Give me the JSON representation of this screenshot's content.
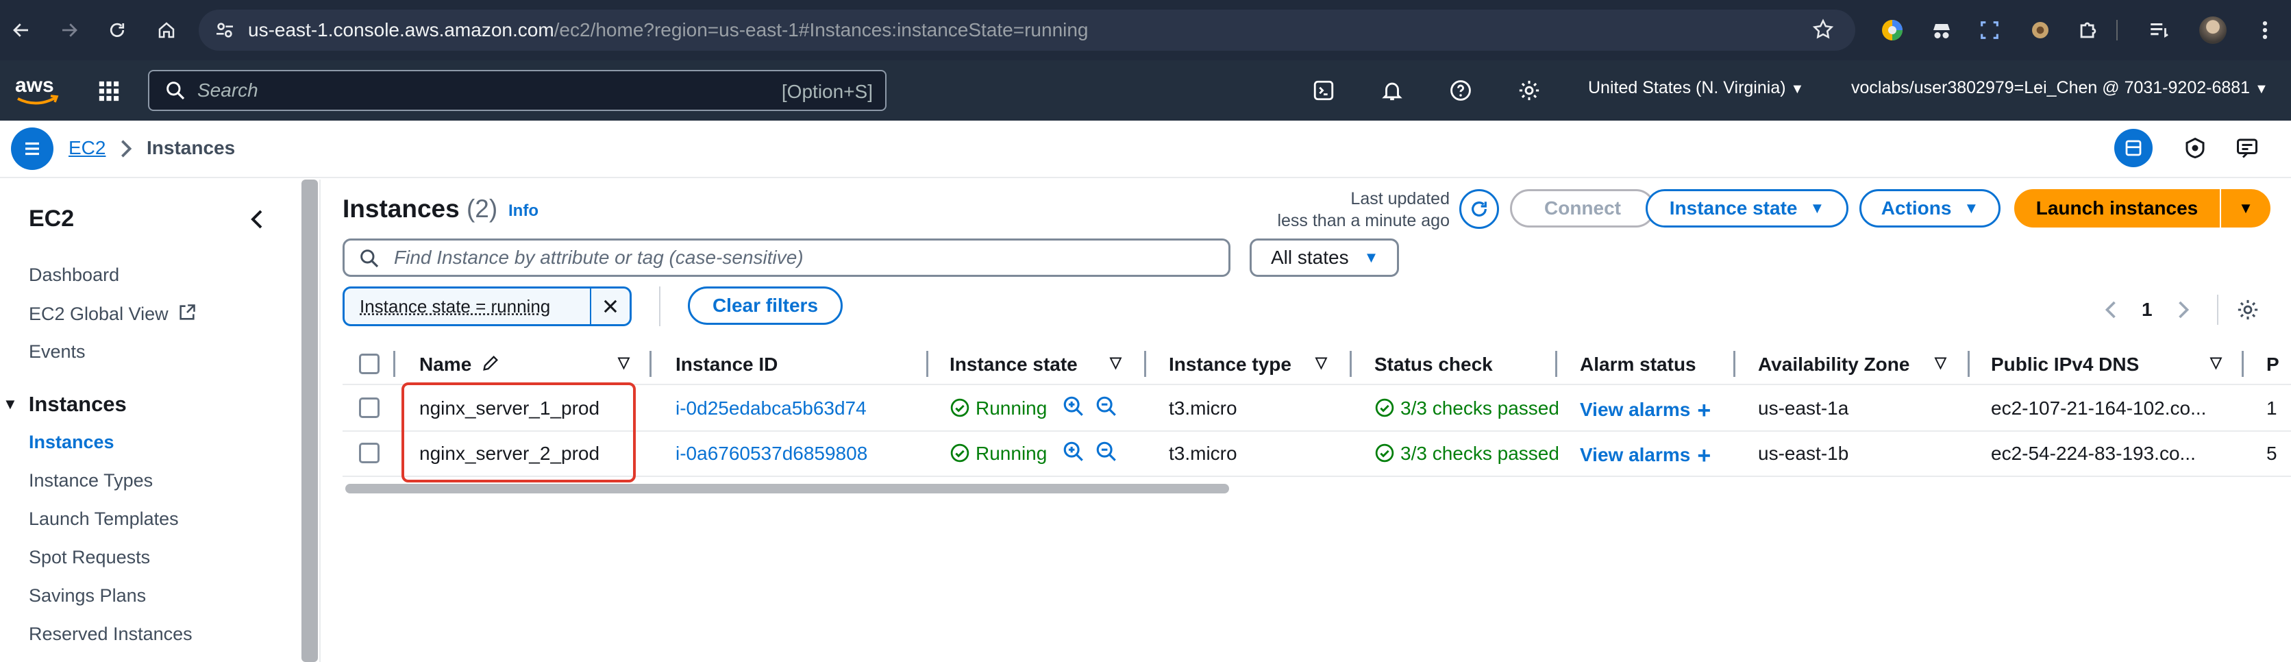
{
  "browser": {
    "url_host": "us-east-1.console.aws.amazon.com",
    "url_path": "/ec2/home?region=us-east-1#Instances:instanceState=running"
  },
  "header": {
    "search_placeholder": "Search",
    "search_shortcut": "[Option+S]",
    "region": "United States (N. Virginia)",
    "account": "voclabs/user3802979=Lei_Chen @ 7031-9202-6881"
  },
  "breadcrumb": {
    "root": "EC2",
    "current": "Instances"
  },
  "sidebar": {
    "title": "EC2",
    "items": [
      "Dashboard",
      "EC2 Global View",
      "Events"
    ],
    "section": "Instances",
    "sub_items": [
      "Instances",
      "Instance Types",
      "Launch Templates",
      "Spot Requests",
      "Savings Plans",
      "Reserved Instances"
    ]
  },
  "main": {
    "title": "Instances",
    "count": "(2)",
    "info": "Info",
    "last_updated_label": "Last updated",
    "last_updated_value": "less than a minute ago",
    "connect_label": "Connect",
    "instance_state_label": "Instance state",
    "actions_label": "Actions",
    "launch_label": "Launch instances",
    "filter_placeholder": "Find Instance by attribute or tag (case-sensitive)",
    "states_select": "All states",
    "filter_token": "Instance state = running",
    "clear_filters": "Clear filters",
    "page": "1"
  },
  "table": {
    "columns": [
      "Name",
      "Instance ID",
      "Instance state",
      "Instance type",
      "Status check",
      "Alarm status",
      "Availability Zone",
      "Public IPv4 DNS",
      "P"
    ],
    "rows": [
      {
        "name": "nginx_server_1_prod",
        "id": "i-0d25edabca5b63d74",
        "state": "Running",
        "type": "t3.micro",
        "status": "3/3 checks passed",
        "alarm": "View alarms",
        "az": "us-east-1a",
        "dns": "ec2-107-21-164-102.co...",
        "extra": "1"
      },
      {
        "name": "nginx_server_2_prod",
        "id": "i-0a6760537d6859808",
        "state": "Running",
        "type": "t3.micro",
        "status": "3/3 checks passed",
        "alarm": "View alarms",
        "az": "us-east-1b",
        "dns": "ec2-54-224-83-193.co...",
        "extra": "5"
      }
    ]
  },
  "colors": {
    "accent": "#0972d3",
    "launch": "#ff9900",
    "highlight": "#e0392b",
    "running": "#037f0c"
  }
}
